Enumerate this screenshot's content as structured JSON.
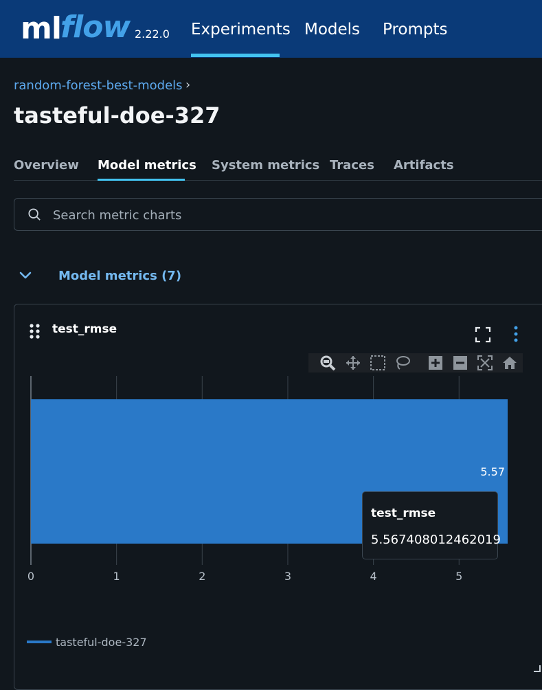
{
  "header": {
    "logo_ml": "ml",
    "logo_flow": "flow",
    "version": "2.22.0",
    "nav": [
      {
        "label": "Experiments",
        "active": true
      },
      {
        "label": "Models",
        "active": false
      },
      {
        "label": "Prompts",
        "active": false
      }
    ]
  },
  "breadcrumb": {
    "experiment": "random-forest-best-models",
    "separator": "›"
  },
  "run_title": "tasteful-doe-327",
  "tabs": [
    {
      "label": "Overview",
      "active": false
    },
    {
      "label": "Model metrics",
      "active": true
    },
    {
      "label": "System metrics",
      "active": false
    },
    {
      "label": "Traces",
      "active": false
    },
    {
      "label": "Artifacts",
      "active": false
    }
  ],
  "search": {
    "placeholder": "Search metric charts",
    "value": ""
  },
  "section": {
    "title": "Model metrics (7)",
    "expanded": true
  },
  "card": {
    "title": "test_rmse",
    "modebar_icons": [
      "zoom-icon",
      "pan-icon",
      "box-select-icon",
      "lasso-select-icon",
      "zoom-in-icon",
      "zoom-out-icon",
      "autoscale-icon",
      "reset-axes-icon"
    ]
  },
  "chart_data": {
    "type": "bar",
    "orientation": "horizontal",
    "categories": [
      "tasteful-doe-327"
    ],
    "values": [
      5.567408012462019
    ],
    "data_labels": [
      "5.57"
    ],
    "xlim": [
      0,
      5.567408012462019
    ],
    "x_ticks": [
      0,
      1,
      2,
      3,
      4,
      5
    ],
    "x_tick_labels": [
      "0",
      "1",
      "2",
      "3",
      "4",
      "5"
    ],
    "grid": true,
    "legend": [
      {
        "name": "tasteful-doe-327",
        "color": "#2a79c8"
      }
    ],
    "legend_position": "bottom-left",
    "bar_color": "#2a79c8"
  },
  "tooltip": {
    "name": "test_rmse",
    "value": "5.567408012462019"
  },
  "colors": {
    "header_bg": "#0a3a78",
    "accent": "#43c3f0",
    "link": "#5da9ee",
    "page_bg": "#11171d",
    "bar": "#2a79c8"
  }
}
